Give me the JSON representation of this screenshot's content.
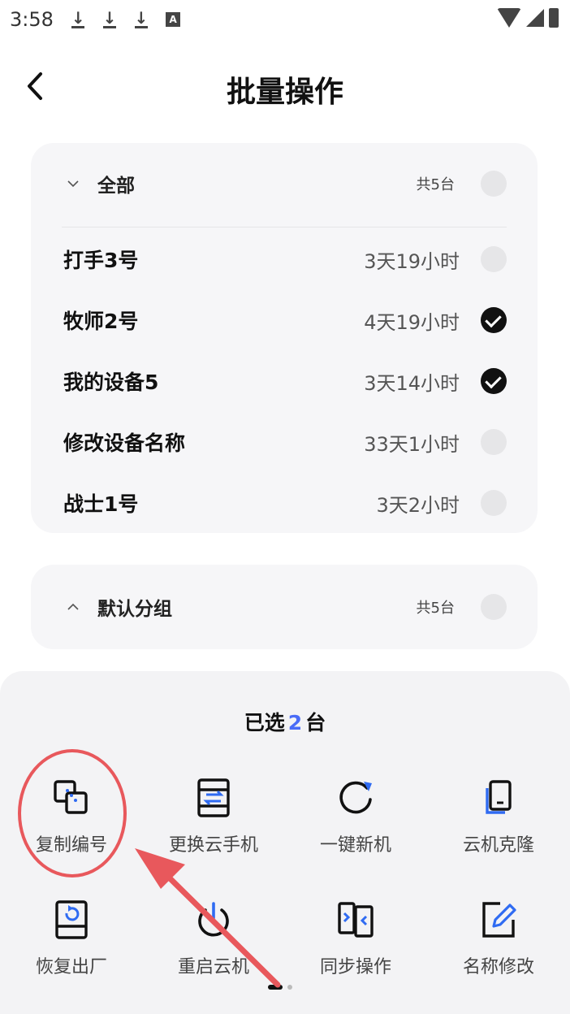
{
  "status_bar": {
    "time": "3:58",
    "download_icons": [
      "download-icon",
      "download-icon",
      "download-icon"
    ],
    "a_badge": "A"
  },
  "header": {
    "title": "批量操作"
  },
  "all_group": {
    "label": "全部",
    "count": "共5台",
    "expanded": true,
    "checked": false,
    "devices": [
      {
        "name": "打手3号",
        "time": "3天19小时",
        "checked": false
      },
      {
        "name": "牧师2号",
        "time": "4天19小时",
        "checked": true
      },
      {
        "name": "我的设备5",
        "time": "3天14小时",
        "checked": true
      },
      {
        "name": "修改设备名称",
        "time": "33天1小时",
        "checked": false
      },
      {
        "name": "战士1号",
        "time": "3天2小时",
        "checked": false
      }
    ]
  },
  "default_group": {
    "label": "默认分组",
    "count": "共5台",
    "expanded": false,
    "checked": false
  },
  "sheet": {
    "selected_prefix": "已选",
    "selected_count": "2",
    "selected_suffix": "台",
    "actions": [
      {
        "label": "复制编号",
        "icon": "copy-id-icon"
      },
      {
        "label": "更换云手机",
        "icon": "swap-phone-icon"
      },
      {
        "label": "一键新机",
        "icon": "refresh-icon"
      },
      {
        "label": "云机克隆",
        "icon": "clone-icon"
      },
      {
        "label": "恢复出厂",
        "icon": "factory-reset-icon"
      },
      {
        "label": "重启云机",
        "icon": "power-icon"
      },
      {
        "label": "同步操作",
        "icon": "sync-icon"
      },
      {
        "label": "名称修改",
        "icon": "edit-icon"
      }
    ],
    "page_count": 2,
    "current_page": 1
  },
  "colors": {
    "accent": "#4a6cf7",
    "icon_blue": "#2f6bf2",
    "annotation": "#e8585c",
    "card_bg": "#f6f6f8",
    "sheet_bg": "#f3f3f5"
  }
}
